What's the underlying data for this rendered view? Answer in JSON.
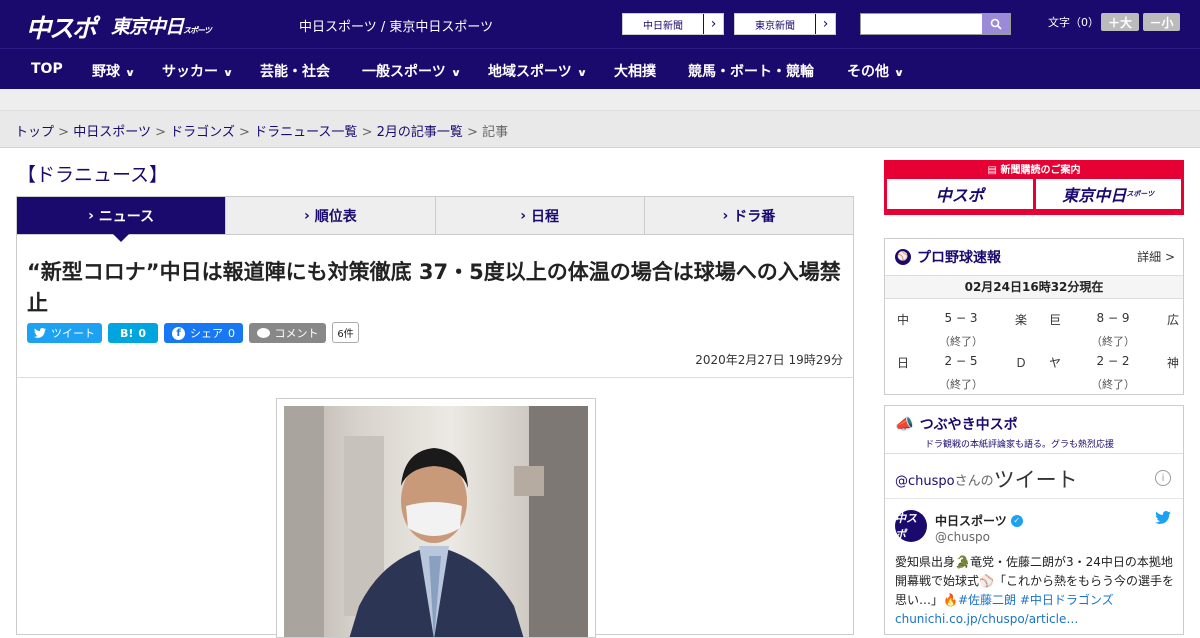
{
  "header": {
    "logo_chuspo": "中スポ",
    "logo_tokyo": "東京中日",
    "logo_tokyo_small": "スポーツ",
    "site_names": "中日スポーツ / 東京中日スポーツ",
    "paper_links": [
      "中日新聞",
      "東京新聞"
    ],
    "search": {
      "placeholder": ""
    },
    "font_size_label": "文字（0）",
    "font_bigger": "＋大",
    "font_smaller": "－小"
  },
  "nav": {
    "items": [
      {
        "label": "TOP"
      },
      {
        "label": "野球"
      },
      {
        "label": "サッカー"
      },
      {
        "label": "芸能・社会"
      },
      {
        "label": "一般スポーツ"
      },
      {
        "label": "地域スポーツ"
      },
      {
        "label": "大相撲"
      },
      {
        "label": "競馬・ボート・競輪"
      },
      {
        "label": "その他"
      }
    ]
  },
  "breadcrumb": {
    "items": [
      "トップ",
      "中日スポーツ",
      "ドラゴンズ",
      "ドラニュース一覧",
      "2月の記事一覧"
    ],
    "current": "記事",
    "separator": ">"
  },
  "section_title": "【ドラニュース】",
  "tabs": [
    {
      "label": "ニュース"
    },
    {
      "label": "順位表"
    },
    {
      "label": "日程"
    },
    {
      "label": "ドラ番"
    }
  ],
  "article": {
    "headline": "“新型コロナ”中日は報道陣にも対策徹底 37・5度以上の体温の場合は球場への入場禁止",
    "share": {
      "tweet": "ツイート",
      "hatena": "B!",
      "hatena_count": "0",
      "facebook": "シェア",
      "facebook_count": "0",
      "comment": "コメント",
      "comment_count": "6件"
    },
    "date": "2020年2月27日 19時29分"
  },
  "sidebar": {
    "ad_title": "新聞購読のご案内",
    "ad_logos": [
      "中スポ",
      "東京中日"
    ],
    "ad_logo_small": "スポーツ",
    "scores": {
      "title": "プロ野球速報",
      "detail": "詳細 >",
      "time": "02月24日16時32分現在",
      "games": [
        {
          "home": "中",
          "score": "5 − 3",
          "away": "楽",
          "status": "（終了）"
        },
        {
          "home": "巨",
          "score": "8 − 9",
          "away": "広",
          "status": "（終了）"
        },
        {
          "home": "日",
          "score": "2 − 5",
          "away": "Ｄ",
          "status": "（終了）"
        },
        {
          "home": "ヤ",
          "score": "2 − 2",
          "away": "神",
          "status": "（終了）"
        }
      ]
    },
    "twitter": {
      "title": "つぶやき中スポ",
      "subtitle": "ドラ観戦の本紙評論家も語る。グラも熱烈応援",
      "handle_link": "@chuspo",
      "san_no": "さんの",
      "tweet_word": "ツイート",
      "avatar_text": "中スポ",
      "account_name": "中日スポーツ",
      "account_handle": "@chuspo",
      "text_1": "愛知県出身🐊竜党・佐藤二朗が3・24中日の本拠地開幕戦で始球式⚾「これから熱をもらう今の選手を思い…」🔥",
      "tags": "#佐藤二朗 #中日ドラゴンズ",
      "link": "chunichi.co.jp/chuspo/article…"
    }
  },
  "colors": {
    "brand": "#1a0a6e",
    "ad_red": "#e60033",
    "twitter": "#1da1f2"
  }
}
